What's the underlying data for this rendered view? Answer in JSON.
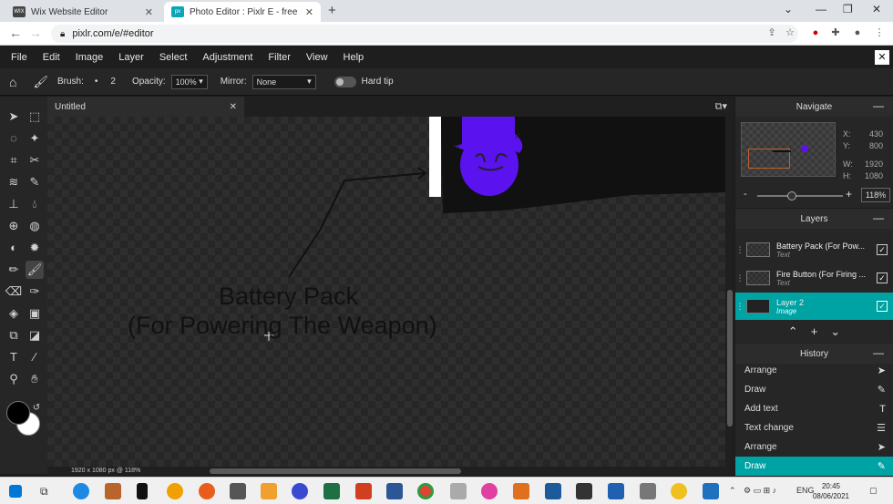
{
  "browser": {
    "tabs": [
      {
        "title": "Wix Website Editor",
        "favicon": "WIX"
      },
      {
        "title": "Photo Editor : Pixlr E - free image",
        "favicon": "px"
      }
    ],
    "url": "pixlr.com/e/#editor"
  },
  "menu": [
    "File",
    "Edit",
    "Image",
    "Layer",
    "Select",
    "Adjustment",
    "Filter",
    "View",
    "Help"
  ],
  "tool_options": {
    "brush_label": "Brush:",
    "brush_size": "2",
    "opacity_label": "Opacity:",
    "opacity_value": "100%",
    "mirror_label": "Mirror:",
    "mirror_value": "None",
    "hard_tip_label": "Hard tip"
  },
  "document": {
    "tab_title": "Untitled",
    "canvas_text_line1": "Battery Pack",
    "canvas_text_line2": "(For Powering The Weapon)",
    "status": "1920 x 1080 px @ 118%"
  },
  "navigate": {
    "title": "Navigate",
    "x_label": "X:",
    "x_value": "430",
    "y_label": "Y:",
    "y_value": "800",
    "w_label": "W:",
    "w_value": "1920",
    "h_label": "H:",
    "h_value": "1080",
    "zoom": "118%",
    "zoom_fraction": 0.4
  },
  "layers": {
    "title": "Layers",
    "items": [
      {
        "name": "Battery Pack (For Pow...",
        "type": "Text"
      },
      {
        "name": "Fire Button (For Firing ...",
        "type": "Text"
      },
      {
        "name": "Layer 2",
        "type": "Image"
      }
    ]
  },
  "history": {
    "title": "History",
    "items": [
      "Arrange",
      "Draw",
      "Add text",
      "Text change",
      "Arrange",
      "Draw"
    ]
  },
  "taskbar": {
    "time": "20:45",
    "date": "08/06/2021",
    "lang": "ENG"
  },
  "colors": {
    "accent": "#00a3a3",
    "purple_shape": "#5a12ee",
    "primary_color": "#000000",
    "secondary_color": "#ffffff"
  }
}
